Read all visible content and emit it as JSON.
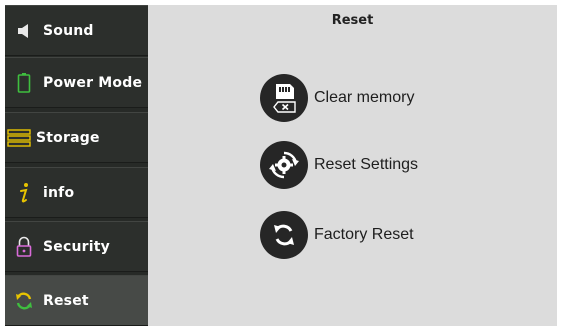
{
  "sidebar": {
    "items": [
      {
        "label": "Sound",
        "icon": "speaker-icon"
      },
      {
        "label": "Power Mode",
        "icon": "battery-icon"
      },
      {
        "label": "Storage",
        "icon": "storage-icon"
      },
      {
        "label": "info",
        "icon": "info-icon"
      },
      {
        "label": "Security",
        "icon": "padlock-icon"
      },
      {
        "label": "Reset",
        "icon": "reset-arrows-icon",
        "active": true
      }
    ]
  },
  "main": {
    "title": "Reset",
    "actions": [
      {
        "label": "Clear memory",
        "icon": "sd-card-clear-icon"
      },
      {
        "label": "Reset Settings",
        "icon": "gear-reset-icon"
      },
      {
        "label": "Factory Reset",
        "icon": "refresh-icon"
      }
    ]
  },
  "colors": {
    "sidebar_bg": "#272a27",
    "active_bg": "#474a47",
    "content_bg": "#dcdcdc",
    "battery_green": "#3fbf3f",
    "storage_yellow": "#e8c400",
    "info_yellow": "#e8c400",
    "lock_pink": "#d86bd8",
    "reset_yellow": "#e8c400",
    "reset_green": "#3fbf3f"
  }
}
